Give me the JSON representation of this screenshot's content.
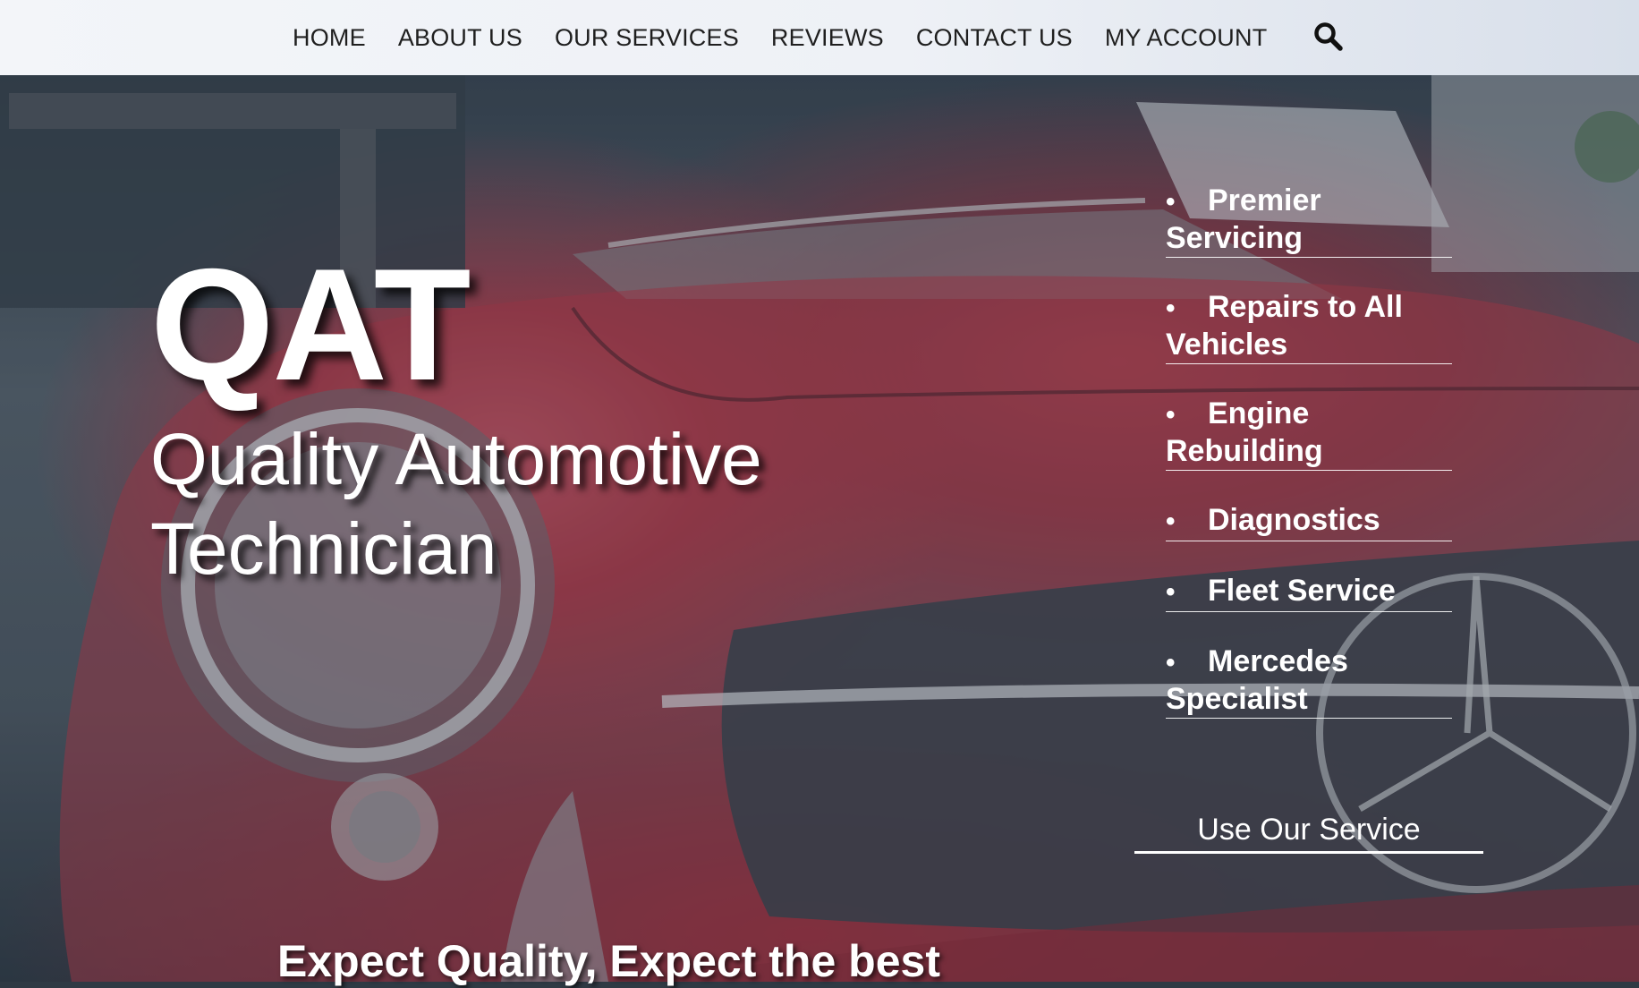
{
  "nav": {
    "items": [
      {
        "label": "HOME"
      },
      {
        "label": "ABOUT US"
      },
      {
        "label": "OUR SERVICES"
      },
      {
        "label": "REVIEWS"
      },
      {
        "label": "CONTACT US"
      },
      {
        "label": "MY ACCOUNT"
      }
    ],
    "search_icon": "search-icon"
  },
  "hero": {
    "title": "QAT",
    "subtitle_line1": "Quality Automotive",
    "subtitle_line2": "Technician",
    "background_image": "red classic Mercedes car front with headlight and grille",
    "services": [
      {
        "label": "Premier Servicing"
      },
      {
        "label": "Repairs to All Vehicles"
      },
      {
        "label": "Engine Rebuilding"
      },
      {
        "label": "Diagnostics"
      },
      {
        "label": "Fleet Service"
      },
      {
        "label": "Mercedes Specialist"
      }
    ],
    "cta_label": "Use Our Service",
    "tagline": "Expect Quality, Expect the best"
  },
  "colors": {
    "nav_background": "#eef1f6",
    "nav_text": "#1f1f1f",
    "hero_text": "#ffffff",
    "car_red": "#b8434f"
  }
}
